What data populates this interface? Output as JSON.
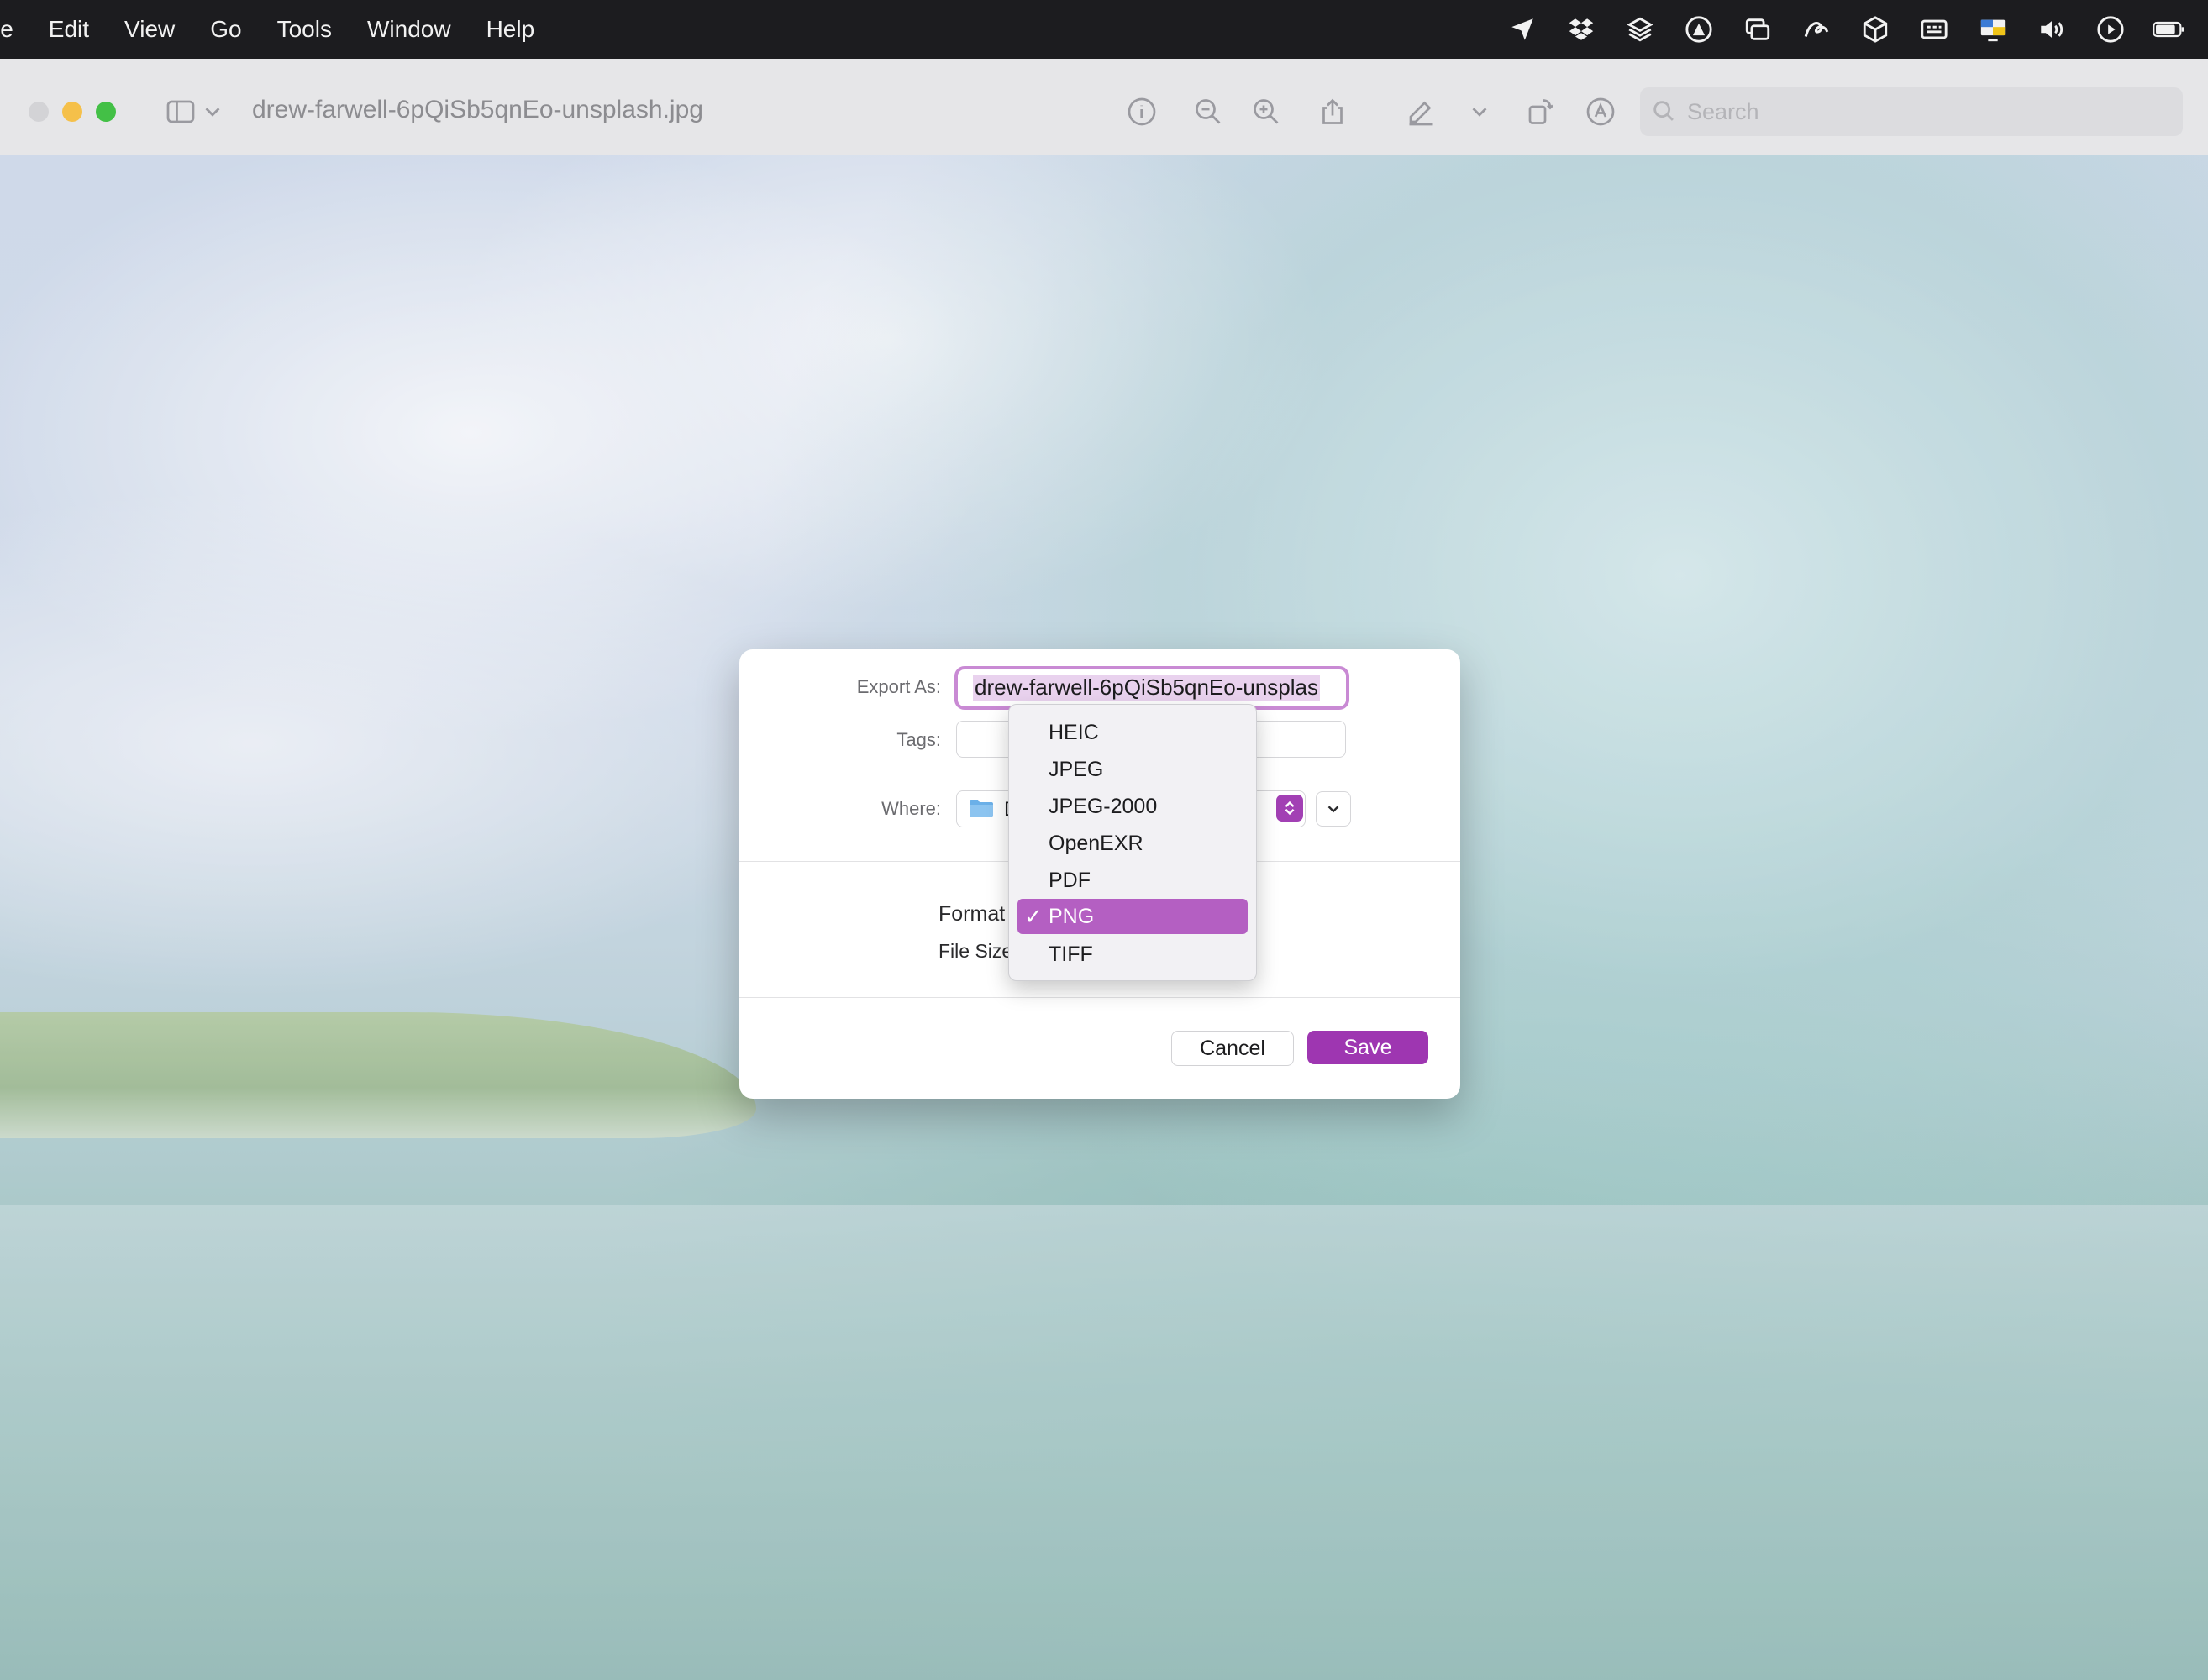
{
  "menubar": {
    "items": [
      "le",
      "Edit",
      "View",
      "Go",
      "Tools",
      "Window",
      "Help"
    ]
  },
  "status_icons": [
    "location-arrow-icon",
    "dropbox-icon",
    "layers-icon",
    "record-icon",
    "windows-icon",
    "scribble-icon",
    "box-icon",
    "keyboard-input-icon",
    "display-icon",
    "volume-icon",
    "play-icon",
    "battery-icon"
  ],
  "window": {
    "title": "drew-farwell-6pQiSb5qnEo-unsplash.jpg",
    "search_placeholder": "Search"
  },
  "dialog": {
    "export_as_label": "Export As:",
    "export_as_value": "drew-farwell-6pQiSb5qnEo-unsplas",
    "tags_label": "Tags:",
    "where_label": "Where:",
    "where_value": "D",
    "format_label": "Format",
    "file_size_label": "File Size",
    "cancel_label": "Cancel",
    "save_label": "Save"
  },
  "format_menu": {
    "options": [
      "HEIC",
      "JPEG",
      "JPEG-2000",
      "OpenEXR",
      "PDF",
      "PNG",
      "TIFF"
    ],
    "selected": "PNG",
    "check": "✓"
  },
  "colors": {
    "accent": "#9e36b1",
    "menu_highlight": "#b45fc2",
    "menubar_bg": "#1c1c1f"
  }
}
